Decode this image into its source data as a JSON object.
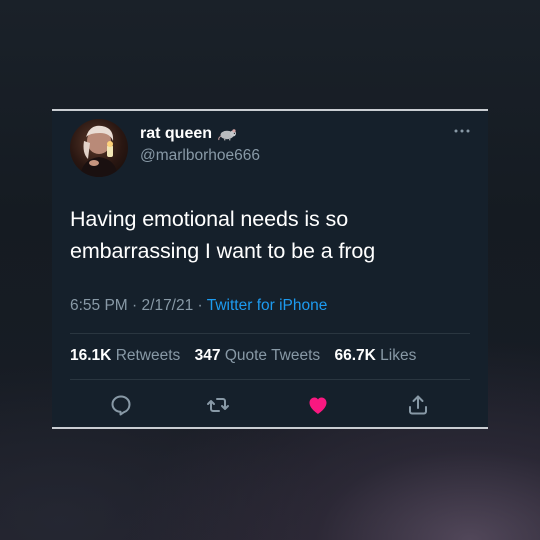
{
  "tweet": {
    "author": {
      "name": "rat queen",
      "name_emoji": "rat-icon",
      "handle": "@marlborhoe666"
    },
    "text_lines": [
      "Having emotional needs is so",
      "embarrassing I want to be a frog"
    ],
    "time": "6:55 PM",
    "date": "2/17/21",
    "source": "Twitter for iPhone",
    "stats": {
      "retweets_count": "16.1K",
      "retweets_label": "Retweets",
      "quote_count": "347",
      "quote_label": "Quote Tweets",
      "likes_count": "66.7K",
      "likes_label": "Likes"
    },
    "actions": [
      "reply-icon",
      "retweet-icon",
      "like-icon",
      "share-icon"
    ]
  },
  "colors": {
    "card_bg": "#15202b",
    "text": "#ffffff",
    "secondary": "#8899a6",
    "link": "#1d9bf0",
    "like": "#f91880"
  }
}
